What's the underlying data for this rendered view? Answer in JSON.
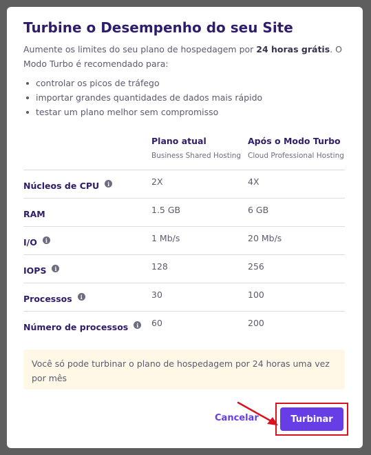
{
  "dialog": {
    "title": "Turbine o Desempenho do seu Site",
    "intro_prefix": "Aumente os limites do seu plano de hospedagem por ",
    "intro_bold": "24 horas grátis",
    "intro_suffix": ". O Modo Turbo é recomendado para:",
    "bullets": [
      "controlar os picos de tráfego",
      "importar grandes quantidades de dados mais rápido",
      "testar um plano melhor sem compromisso"
    ]
  },
  "table": {
    "columns": [
      {
        "title": "Plano atual",
        "subtitle": "Business Shared Hosting"
      },
      {
        "title": "Após o Modo Turbo",
        "subtitle": "Cloud Professional Hosting"
      }
    ],
    "rows": [
      {
        "label": "Núcleos de CPU",
        "info": true,
        "current": "2X",
        "turbo": "4X"
      },
      {
        "label": "RAM",
        "info": false,
        "current": "1.5 GB",
        "turbo": "6 GB"
      },
      {
        "label": "I/O",
        "info": true,
        "current": "1 Mb/s",
        "turbo": "20 Mb/s"
      },
      {
        "label": "IOPS",
        "info": true,
        "current": "128",
        "turbo": "256"
      },
      {
        "label": "Processos",
        "info": true,
        "current": "30",
        "turbo": "100"
      },
      {
        "label": "Número de processos",
        "info": true,
        "current": "60",
        "turbo": "200"
      }
    ]
  },
  "notice": "Você só pode turbinar o plano de hospedagem por 24 horas uma vez por mês",
  "footer": {
    "cancel_label": "Cancelar",
    "turbo_label": "Turbinar"
  },
  "colors": {
    "brand": "#673de6",
    "heading": "#2f1c6a",
    "notice_bg": "#fff8e6",
    "highlight": "#d9121f"
  },
  "icons": {
    "info": "info-icon",
    "annotation_arrow": "arrow-annotation-icon"
  }
}
